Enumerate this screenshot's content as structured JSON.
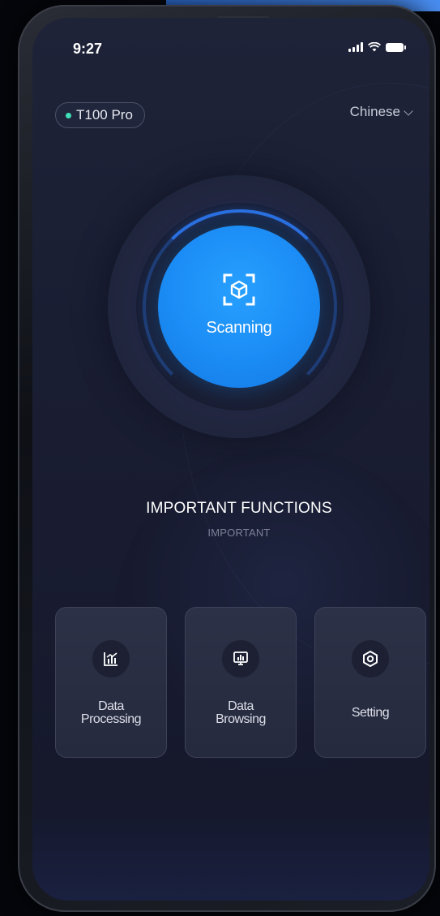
{
  "status_bar": {
    "time": "9:27"
  },
  "device": {
    "name": "T100 Pro",
    "status_color": "#3fe0b8"
  },
  "language": {
    "current": "Chinese"
  },
  "scan": {
    "label": "Scanning",
    "accent": "#1b8cf5",
    "icon": "scan-cube-icon"
  },
  "section": {
    "title": "IMPORTANT FUNCTIONS",
    "subtitle": "IMPORTANT"
  },
  "functions": [
    {
      "label": "Data\nProcessing",
      "icon": "bar-chart-icon"
    },
    {
      "label": "Data\nBrowsing",
      "icon": "monitor-chart-icon"
    },
    {
      "label": "Setting",
      "icon": "settings-hex-icon"
    }
  ]
}
